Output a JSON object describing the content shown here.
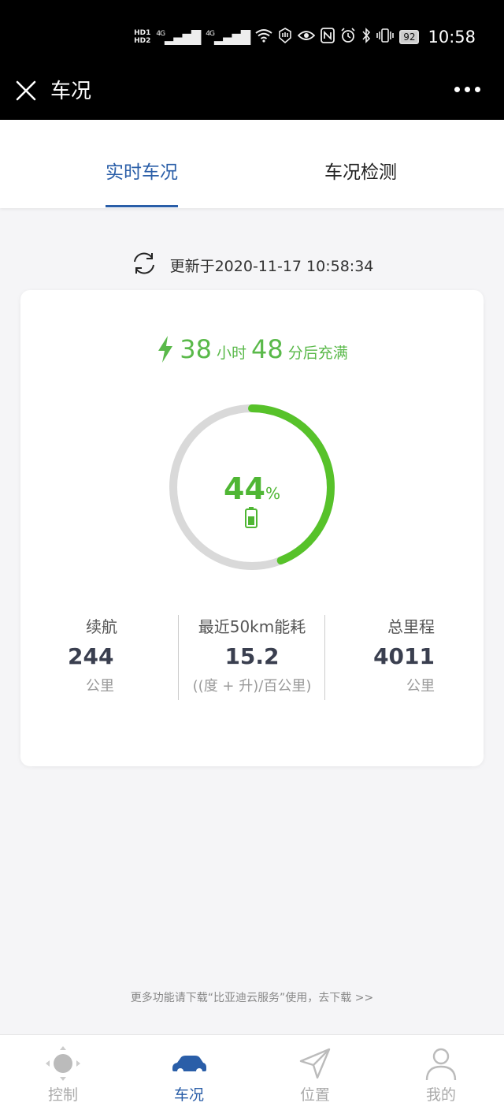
{
  "status_bar": {
    "hd1": "HD1",
    "hd2": "HD2",
    "signal1": "4G",
    "signal2": "4G",
    "battery": "92",
    "time": "10:58"
  },
  "header": {
    "title": "车况",
    "close_icon": "close-icon",
    "more_icon": "more-icon"
  },
  "tabs": [
    {
      "label": "实时车况",
      "active": true
    },
    {
      "label": "车况检测",
      "active": false
    }
  ],
  "update": {
    "text": "更新于2020-11-17 10:58:34"
  },
  "charge": {
    "hours": "38",
    "hours_unit": "小时",
    "minutes": "48",
    "minutes_unit": "分后充满"
  },
  "battery": {
    "percent": "44",
    "percent_unit": "%",
    "level": 0.44
  },
  "stats": [
    {
      "label": "续航",
      "value": "244",
      "unit": "公里"
    },
    {
      "label": "最近50km能耗",
      "value": "15.2",
      "unit": "((度 + 升)/百公里)"
    },
    {
      "label": "总里程",
      "value": "4011",
      "unit": "公里"
    }
  ],
  "promo": "更多功能请下载“比亚迪云服务”使用，去下载 >>",
  "bottom_nav": [
    {
      "label": "控制",
      "icon": "control-icon",
      "active": false
    },
    {
      "label": "车况",
      "icon": "car-icon",
      "active": true
    },
    {
      "label": "位置",
      "icon": "location-icon",
      "active": false
    },
    {
      "label": "我的",
      "icon": "user-icon",
      "active": false
    }
  ],
  "colors": {
    "accent": "#2a5ea8",
    "green": "#4fb634",
    "ring_bg": "#d9d9d9"
  }
}
